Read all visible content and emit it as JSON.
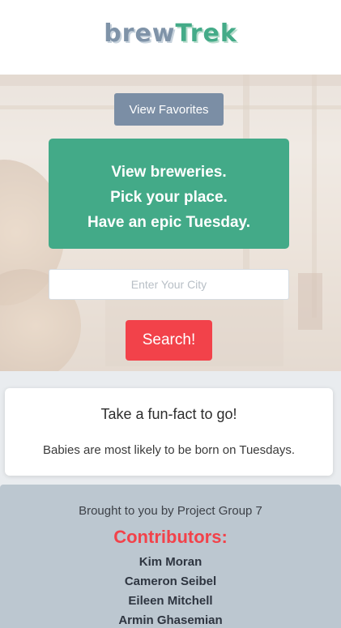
{
  "brand": {
    "part1": "brew",
    "part2": "Trek"
  },
  "hero": {
    "favorites_label": "View Favorites",
    "tagline": [
      "View breweries.",
      "Pick your place.",
      "Have an epic Tuesday."
    ],
    "city_placeholder": "Enter Your City",
    "search_label": "Search!"
  },
  "fact": {
    "title": "Take a fun-fact to go!",
    "text": "Babies are most likely to be born on Tuesdays."
  },
  "footer": {
    "credit": "Brought to you by Project Group 7",
    "contributors_heading": "Contributors:",
    "contributors": [
      "Kim Moran",
      "Cameron Seibel",
      "Eileen Mitchell",
      "Armin Ghasemian"
    ]
  },
  "colors": {
    "brand_slate": "#7f93a8",
    "brand_green": "#44ab88",
    "accent_red": "#f2424a",
    "footer_bg": "#bcc7d0"
  }
}
